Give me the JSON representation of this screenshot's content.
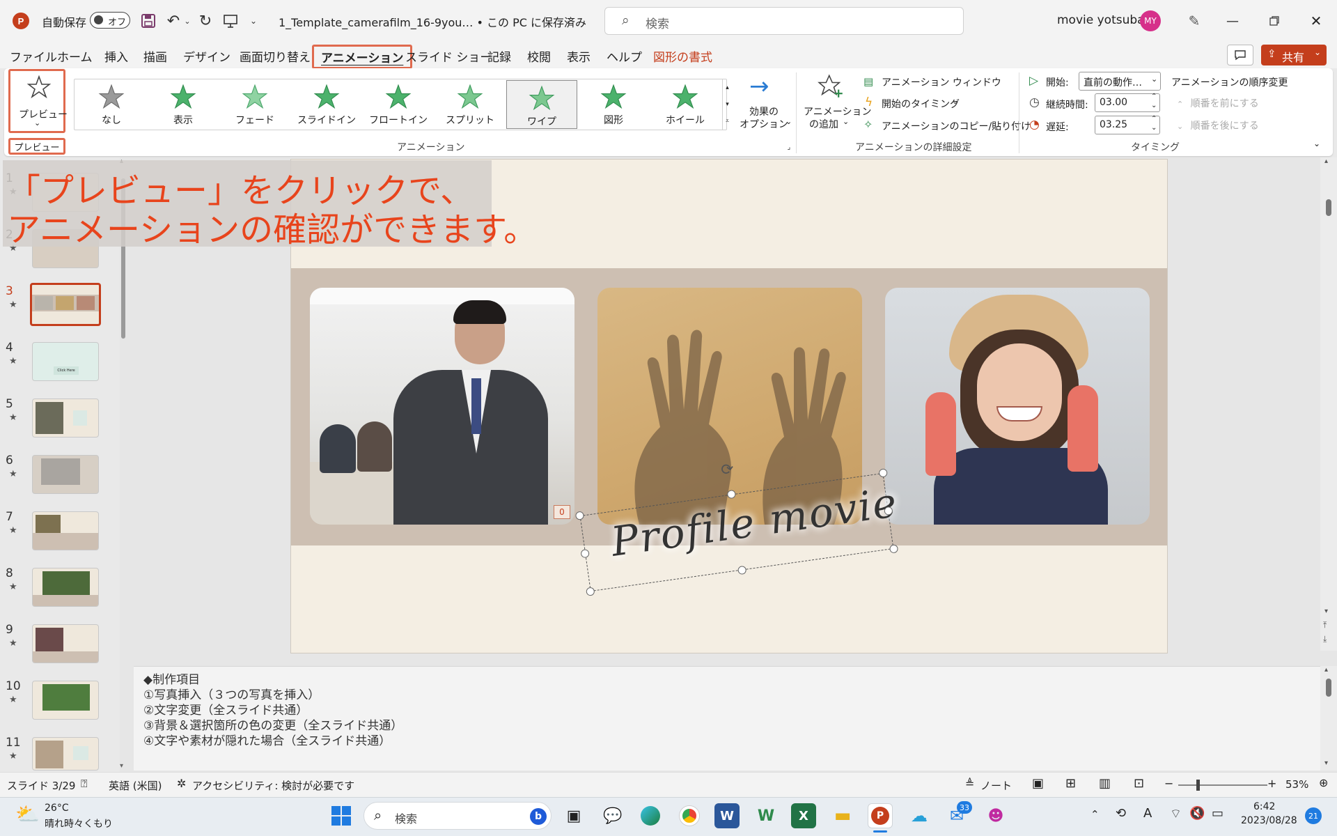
{
  "window": {
    "autosave_label": "自動保存",
    "autosave_state": "オフ",
    "file_title": "1_Template_camerafilm_16-9you… • この PC に保存済み",
    "search_placeholder": "検索",
    "user_name": "movie yotsuba",
    "user_initials": "MY",
    "accent_color": "#c43e1c"
  },
  "menu": {
    "items": [
      "ファイル",
      "ホーム",
      "挿入",
      "描画",
      "デザイン",
      "画面切り替え",
      "アニメーション",
      "スライド ショー",
      "記録",
      "校閲",
      "表示",
      "ヘルプ",
      "図形の書式"
    ],
    "selected": "アニメーション",
    "comment_icon": "comment-icon",
    "share_label": "共有"
  },
  "ribbon": {
    "preview_label": "プレビュー",
    "preview_group_label": "プレビュー",
    "gallery": [
      "なし",
      "表示",
      "フェード",
      "スライドイン",
      "フロートイン",
      "スプリット",
      "ワイプ",
      "図形",
      "ホイール"
    ],
    "gallery_selected": "ワイプ",
    "effect_options_line1": "効果の",
    "effect_options_line2": "オプション",
    "animation_group_label": "アニメーション",
    "add_animation_line1": "アニメーション",
    "add_animation_line2": "の追加",
    "animation_pane": "アニメーション ウィンドウ",
    "trigger": "開始のタイミング",
    "painter": "アニメーションのコピー/貼り付け",
    "advanced_group_label": "アニメーションの詳細設定",
    "start_label": "開始:",
    "start_value": "直前の動作…",
    "duration_label": "継続時間:",
    "duration_value": "03.00",
    "delay_label": "遅延:",
    "delay_value": "03.25",
    "reorder_label": "アニメーションの順序変更",
    "move_earlier": "順番を前にする",
    "move_later": "順番を後にする",
    "timing_group_label": "タイミング"
  },
  "annotation": {
    "line1": "「プレビュー」をクリックで、",
    "line2": "アニメーションの確認ができます。"
  },
  "thumbnails": [
    {
      "num": "1",
      "star": "★"
    },
    {
      "num": "2",
      "star": "★"
    },
    {
      "num": "3",
      "star": "★"
    },
    {
      "num": "4",
      "star": "★"
    },
    {
      "num": "5",
      "star": "★"
    },
    {
      "num": "6",
      "star": "★"
    },
    {
      "num": "7",
      "star": "★"
    },
    {
      "num": "8",
      "star": "★"
    },
    {
      "num": "9",
      "star": "★"
    },
    {
      "num": "10",
      "star": "★"
    },
    {
      "num": "11",
      "star": "★"
    }
  ],
  "slide": {
    "script_text": "Profile movie",
    "anim_badge": "0",
    "thumb4_text": "Click Here"
  },
  "notes": [
    "◆制作項目",
    "①写真挿入（３つの写真を挿入）",
    "②文字変更（全スライド共通）",
    "③背景＆選択箇所の色の変更（全スライド共通）",
    "④文字や素材が隠れた場合（全スライド共通）"
  ],
  "status": {
    "slide": "スライド 3/29",
    "language": "英語 (米国)",
    "accessibility": "アクセシビリティ: 検討が必要です",
    "notes": "ノート",
    "zoom": "53%"
  },
  "taskbar": {
    "temp": "26°C",
    "weather": "晴れ時々くもり",
    "search": "検索",
    "mail_badge": "33",
    "time": "6:42",
    "date": "2023/08/28",
    "notif": "21"
  }
}
